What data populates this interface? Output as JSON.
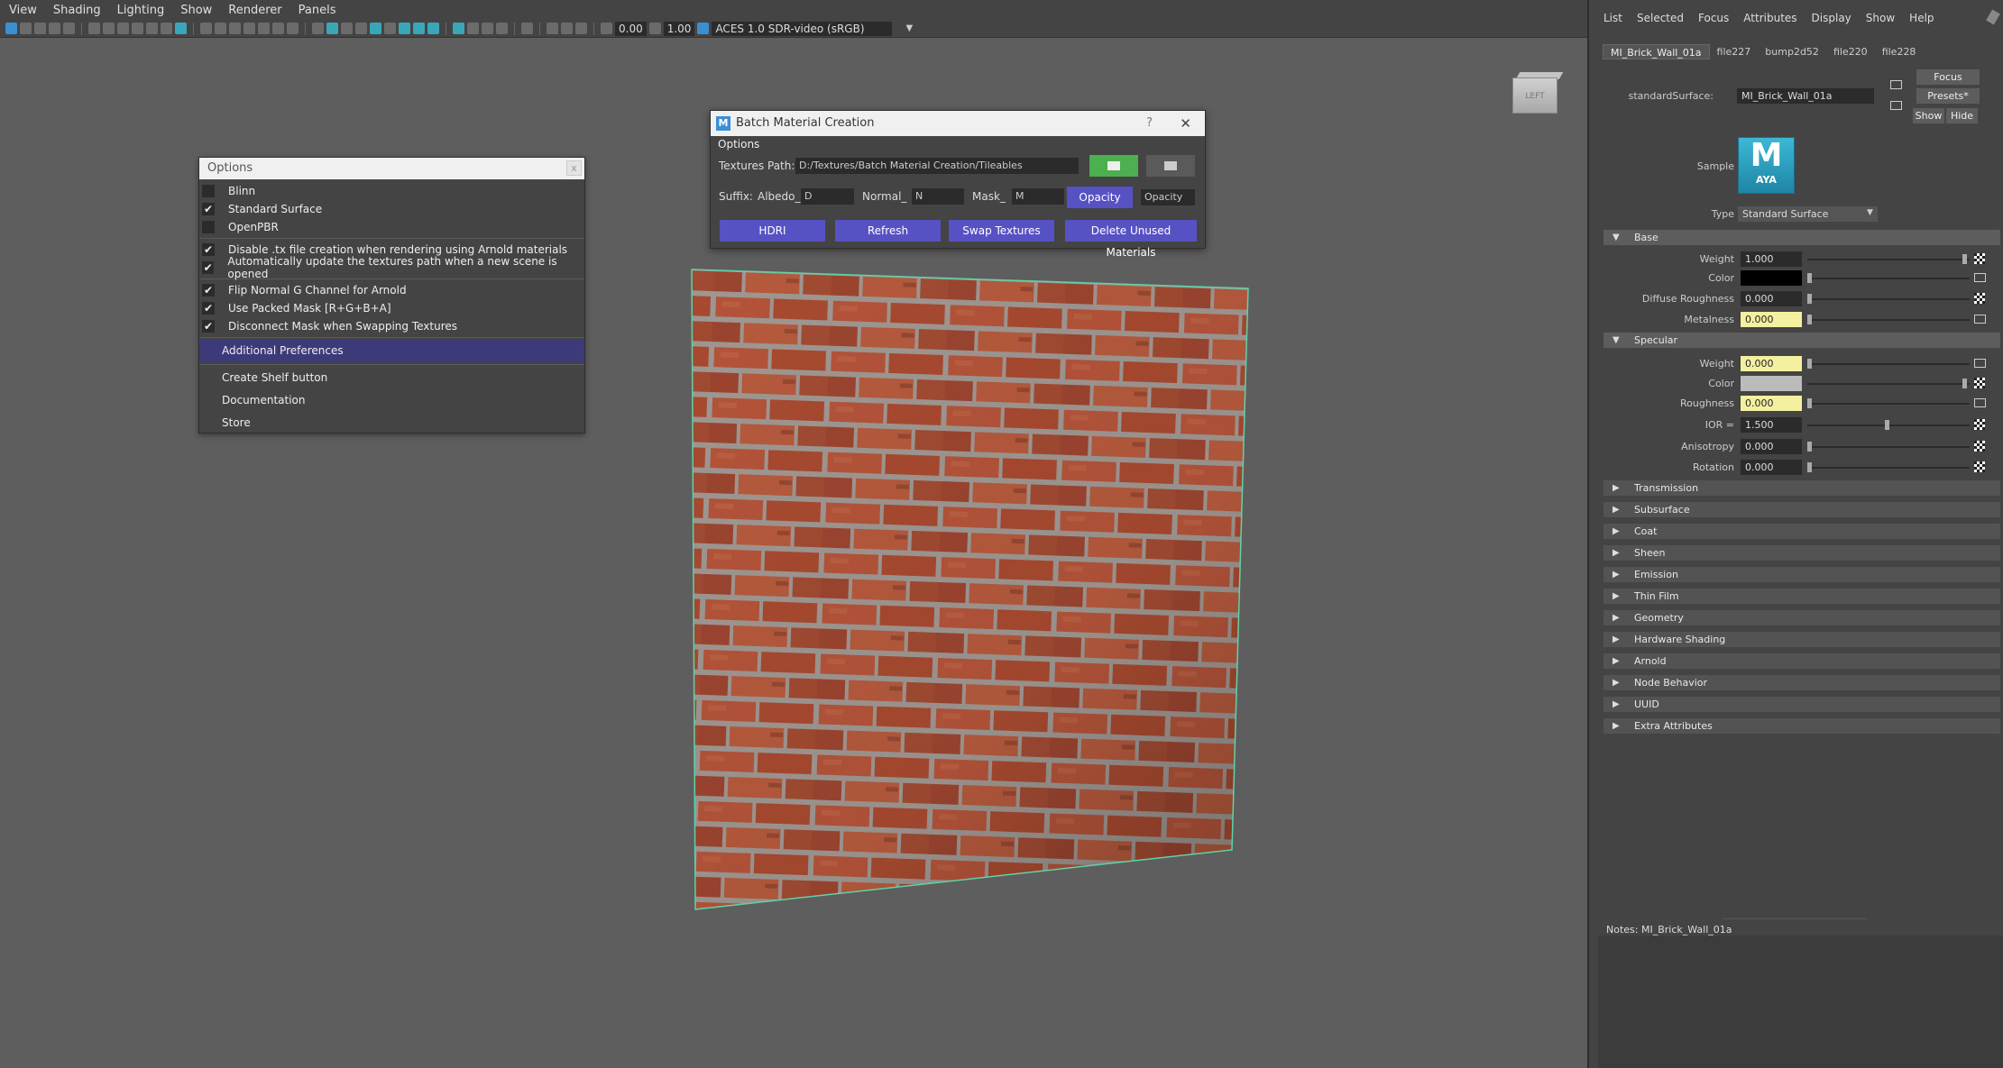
{
  "viewport": {
    "menu": [
      "View",
      "Shading",
      "Lighting",
      "Show",
      "Renderer",
      "Panels"
    ],
    "exposure": "0.00",
    "gamma": "1.00",
    "color_space": "ACES 1.0 SDR-video (sRGB)",
    "viewcube_label": "LEFT"
  },
  "options_panel": {
    "title": "Options",
    "close": "x",
    "checks": [
      {
        "label": "Blinn",
        "checked": ""
      },
      {
        "label": "Standard Surface",
        "checked": "✔"
      },
      {
        "label": "OpenPBR",
        "checked": ""
      }
    ],
    "checks2": [
      {
        "label": "Disable .tx file creation when rendering using Arnold materials",
        "checked": "✔"
      },
      {
        "label": "Automatically update the textures path when a new scene is opened",
        "checked": "✔"
      }
    ],
    "checks3": [
      {
        "label": "Flip Normal G Channel for Arnold",
        "checked": "✔"
      },
      {
        "label": "Use Packed Mask [R+G+B+A]",
        "checked": "✔"
      },
      {
        "label": "Disconnect Mask when Swapping Textures",
        "checked": "✔"
      }
    ],
    "items": [
      "Additional Preferences",
      "Create Shelf button",
      "Documentation",
      "Store"
    ]
  },
  "bmc": {
    "title": "Batch Material Creation",
    "help": "?",
    "close": "✕",
    "menu": "Options",
    "textures_path_label": "Textures Path:",
    "textures_path": "D:/Textures/Batch Material Creation/Tileables",
    "suffix_label": "Suffix:",
    "albedo_label": "Albedo_",
    "albedo": "D",
    "normal_label": "Normal_",
    "normal": "N",
    "mask_label": "Mask_",
    "mask": "M",
    "opacity_btn": "Opacity",
    "opacity": "Opacity",
    "buttons": [
      "HDRI",
      "Refresh",
      "Swap Textures",
      "Delete Unused Materials"
    ]
  },
  "attr": {
    "menu": [
      "List",
      "Selected",
      "Focus",
      "Attributes",
      "Display",
      "Show",
      "Help"
    ],
    "tabs": [
      "MI_Brick_Wall_01a",
      "file227",
      "bump2d52",
      "file220",
      "file228"
    ],
    "node_label": "standardSurface:",
    "node_name": "MI_Brick_Wall_01a",
    "focus": "Focus",
    "presets": "Presets*",
    "show": "Show",
    "hide": "Hide",
    "sample_label": "Sample",
    "sample_icon_letter": "M",
    "sample_icon_text": "AYA",
    "type_label": "Type",
    "type_value": "Standard Surface",
    "base": {
      "title": "Base",
      "weight_label": "Weight",
      "weight": "1.000",
      "color_label": "Color",
      "diffuse_roughness_label": "Diffuse Roughness",
      "diffuse_roughness": "0.000",
      "metalness_label": "Metalness",
      "metalness": "0.000"
    },
    "specular": {
      "title": "Specular",
      "weight_label": "Weight",
      "weight": "0.000",
      "color_label": "Color",
      "roughness_label": "Roughness",
      "roughness": "0.000",
      "ior_label": "IOR =",
      "ior": "1.500",
      "anisotropy_label": "Anisotropy",
      "anisotropy": "0.000",
      "rotation_label": "Rotation",
      "rotation": "0.000"
    },
    "sections": [
      "Transmission",
      "Subsurface",
      "Coat",
      "Sheen",
      "Emission",
      "Thin Film",
      "Geometry",
      "Hardware Shading",
      "Arnold",
      "Node Behavior",
      "UUID",
      "Extra Attributes"
    ],
    "notes_label": "Notes:",
    "notes_value": "MI_Brick_Wall_01a"
  },
  "colors": {
    "accent_button": "#5752c4",
    "selection": "#3d3a7a",
    "browse_green": "#4caf50",
    "wireframe": "#5fd3a8",
    "brick": "#a84a30",
    "mortar": "#9e9691"
  }
}
